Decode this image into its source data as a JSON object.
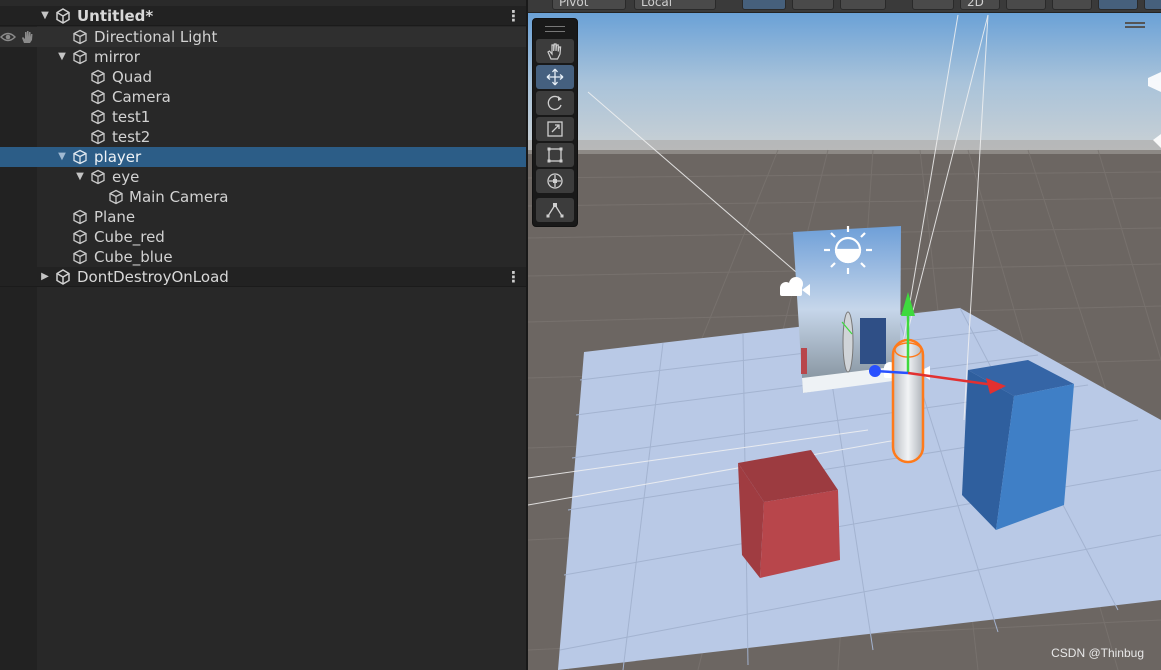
{
  "hierarchy": {
    "scene": {
      "name": "Untitled*",
      "more": "⋮"
    },
    "items": [
      {
        "name": "Directional Light"
      },
      {
        "name": "mirror"
      },
      {
        "name": "Quad"
      },
      {
        "name": "Camera"
      },
      {
        "name": "test1"
      },
      {
        "name": "test2"
      },
      {
        "name": "player"
      },
      {
        "name": "eye"
      },
      {
        "name": "Main Camera"
      },
      {
        "name": "Plane"
      },
      {
        "name": "Cube_red"
      },
      {
        "name": "Cube_blue"
      }
    ],
    "dont_destroy": {
      "name": "DontDestroyOnLoad",
      "more": "⋮"
    }
  },
  "scene_toolbar": {
    "pivot": "Pivot",
    "local": "Local",
    "mode_2d": "2D"
  },
  "tools": [
    "hand-tool",
    "move-tool",
    "rotate-tool",
    "scale-tool",
    "rect-tool",
    "transform-tool",
    "custom-tool"
  ],
  "watermark": "CSDN @Thinbug",
  "colors": {
    "selection": "#2c5d87",
    "sky_top": "#6fa8dc",
    "ground": "#6c6662",
    "plane": "#b9c9e6",
    "cube_red": "#b8464b",
    "cube_blue": "#3f7fc6",
    "gizmo_y": "#3ed93e",
    "gizmo_x": "#e23030",
    "gizmo_z": "#2850ff"
  }
}
